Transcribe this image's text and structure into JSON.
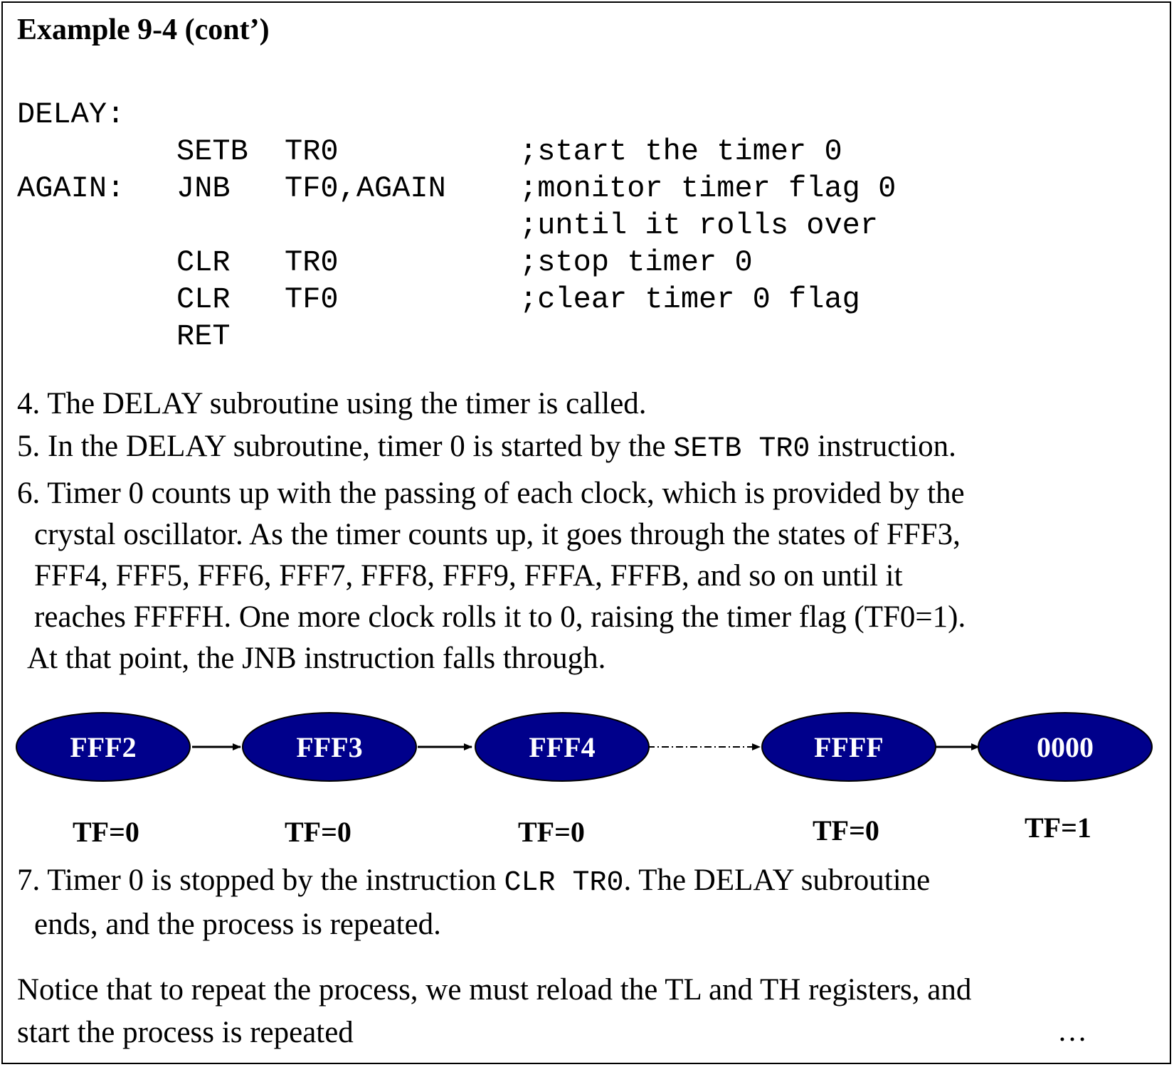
{
  "title": "Example 9-4 (cont’)",
  "code": {
    "line1_label": "DELAY:",
    "line2_op": "SETB",
    "line2_arg": "TR0",
    "line2_cmt": ";start the timer 0",
    "line3_label": "AGAIN:",
    "line3_op": "JNB",
    "line3_arg": "TF0,AGAIN",
    "line3_cmt": ";monitor timer flag 0",
    "line4_cmt": ";until it rolls over",
    "line5_op": "CLR",
    "line5_arg": "TR0",
    "line5_cmt": ";stop timer 0",
    "line6_op": "CLR",
    "line6_arg": "TF0",
    "line6_cmt": ";clear timer 0 flag",
    "line7_op": "RET"
  },
  "steps": {
    "s4": "4. The DELAY subroutine using the timer is called.",
    "s5_a": "5. In the DELAY subroutine, timer 0 is started by the ",
    "s5_code": "SETB TR0",
    "s5_b": " instruction.",
    "s6_l1": "6. Timer 0 counts up with the passing of each clock, which is provided by the",
    "s6_l2": "crystal oscillator. As the timer counts up, it goes through the states of FFF3,",
    "s6_l3": "FFF4, FFF5, FFF6, FFF7, FFF8, FFF9, FFFA, FFFB, and so on until it",
    "s6_l4": "reaches FFFFH. One more clock rolls it to 0, raising the timer flag (TF0=1).",
    "s6_l5": "At that point, the JNB instruction falls through.",
    "s7_a": "7. Timer 0 is stopped by the instruction ",
    "s7_code": "CLR TR0",
    "s7_b": ". The DELAY subroutine",
    "s7_l2": "ends, and the process is repeated.",
    "notice_l1": "Notice that to repeat the process, we must reload the TL and TH registers, and",
    "notice_l2": "start the process is repeated",
    "ellipsis": "…"
  },
  "diagram": {
    "ellipse_color": "#00008B",
    "states": [
      {
        "value": "FFF2",
        "flag": "TF=0"
      },
      {
        "value": "FFF3",
        "flag": "TF=0"
      },
      {
        "value": "FFF4",
        "flag": "TF=0"
      },
      {
        "value": "FFFF",
        "flag": "TF=0"
      },
      {
        "value": "0000",
        "flag": "TF=1"
      }
    ]
  }
}
